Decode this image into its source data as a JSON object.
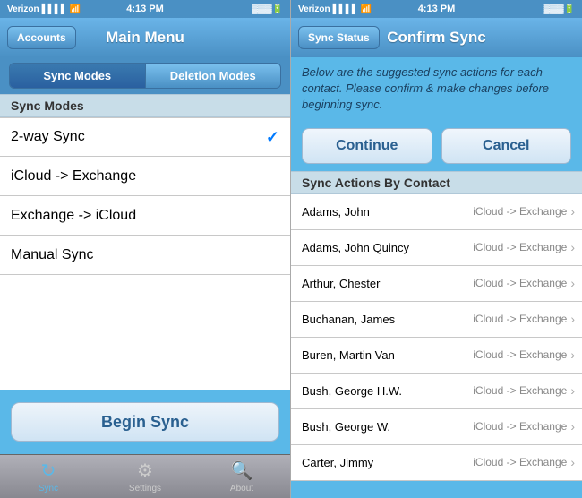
{
  "left": {
    "status": {
      "carrier": "Verizon",
      "signal": "▌▌▌▌",
      "wifi": "WiFi",
      "time": "4:13 PM",
      "battery": "▓▓▓"
    },
    "nav": {
      "back_button": "Accounts",
      "title": "Main Menu"
    },
    "segments": [
      "Sync Modes",
      "Deletion Modes"
    ],
    "section_header": "Sync Modes",
    "rows": [
      {
        "label": "2-way Sync",
        "checked": true
      },
      {
        "label": "iCloud -> Exchange",
        "checked": false
      },
      {
        "label": "Exchange -> iCloud",
        "checked": false
      },
      {
        "label": "Manual Sync",
        "checked": false
      }
    ],
    "begin_sync_label": "Begin Sync",
    "tabs": [
      {
        "icon": "↻",
        "label": "Sync",
        "active": true
      },
      {
        "icon": "⚙",
        "label": "Settings",
        "active": false
      },
      {
        "icon": "🔍",
        "label": "About",
        "active": false
      }
    ]
  },
  "right": {
    "status": {
      "carrier": "Verizon",
      "signal": "▌▌▌▌",
      "wifi": "WiFi",
      "time": "4:13 PM",
      "battery": "▓▓▓"
    },
    "nav": {
      "back_button": "Sync Status",
      "title": "Confirm Sync"
    },
    "info_text": "Below are the suggested sync actions for each contact.  Please confirm & make changes before beginning sync.",
    "continue_label": "Continue",
    "cancel_label": "Cancel",
    "section_header": "Sync Actions By Contact",
    "contacts": [
      {
        "name": "Adams, John",
        "action": "iCloud -> Exchange"
      },
      {
        "name": "Adams, John Quincy",
        "action": "iCloud -> Exchange"
      },
      {
        "name": "Arthur, Chester",
        "action": "iCloud -> Exchange"
      },
      {
        "name": "Buchanan, James",
        "action": "iCloud -> Exchange"
      },
      {
        "name": "Buren, Martin Van",
        "action": "iCloud -> Exchange"
      },
      {
        "name": "Bush, George H.W.",
        "action": "iCloud -> Exchange"
      },
      {
        "name": "Bush, George W.",
        "action": "iCloud -> Exchange"
      },
      {
        "name": "Carter, Jimmy",
        "action": "iCloud -> Exchange"
      }
    ]
  }
}
